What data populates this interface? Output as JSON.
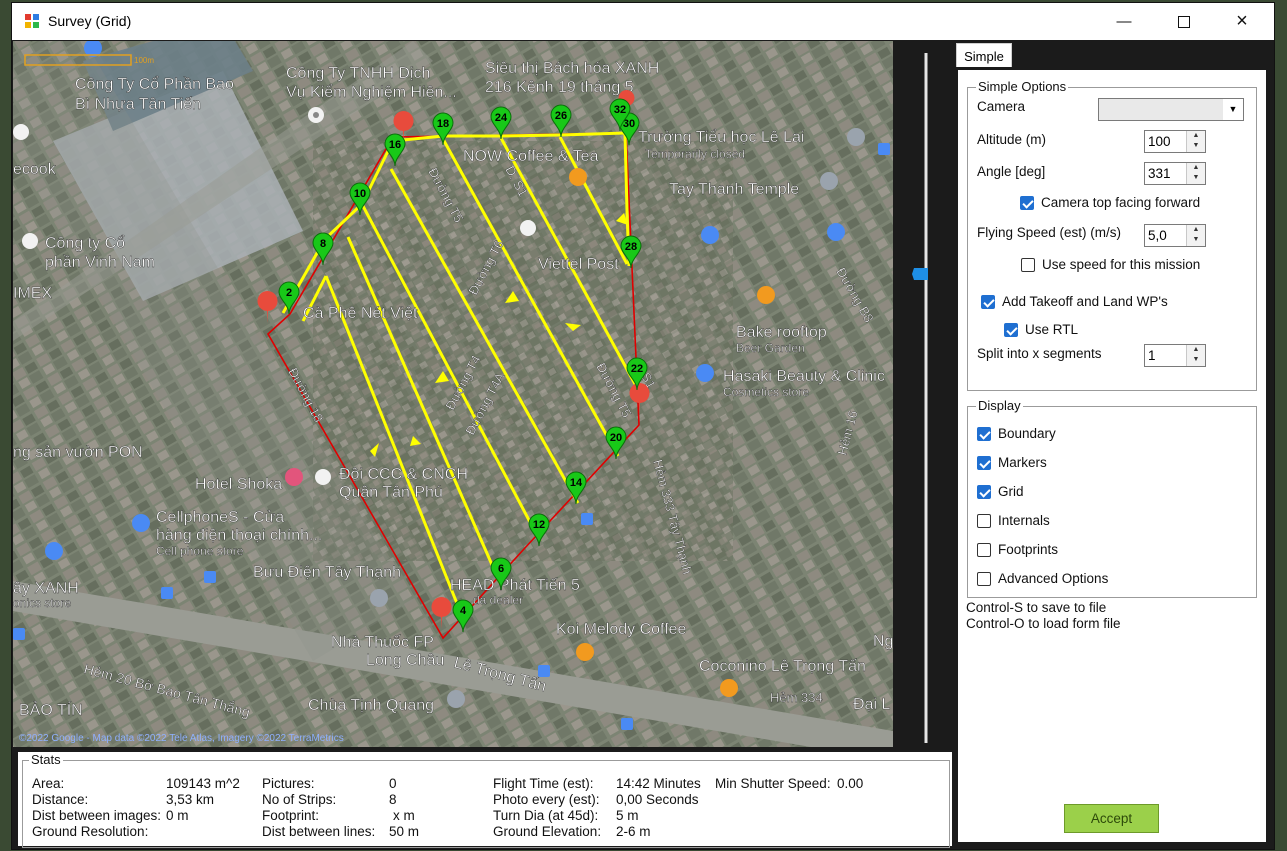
{
  "window": {
    "title": "Survey (Grid)"
  },
  "map": {
    "labels": [
      "Công Ty Cổ Phần Bao",
      "Bì Nhựa Tân Tiến",
      "Công Ty TNHH Dịch",
      "Vụ Kiểm Nghiệm Hiện...",
      "Siêu thị Bách hóa XANH",
      "216 Kênh 19 tháng 5",
      "Trường Tiểu học Lê Lai",
      "Temporarily closed",
      "NOW Coffee & Tea",
      "Tay Thanh Temple",
      "ecook",
      "Công ty Cổ",
      "phần Vinh Nam",
      "IMEX",
      "Viettel Post",
      "Cà Phê Nét Việt",
      "Bake rooftop",
      "Beer Garden",
      "Hasaki Beauty & Clinic",
      "Cosmetics store",
      "ng sản vườn PON",
      "Hotel Shoka",
      "Đội CCC & CNCH",
      "Quận Tân Phú",
      "CellphoneS - Cửa",
      "hàng điện thoại chính...",
      "Cell phone store",
      "Bưu Điện Tây Thạnh",
      "HEAD Phát Tiến 5",
      "da dealer",
      "ây XANH",
      "onics store",
      "Koi Melody Coffee",
      "Nhà Thuốc FP",
      "Long Châu",
      "Lê Trọng Tấn",
      "Coconino Lê Trọng Tấn",
      "Hẻm 334",
      "Đại L",
      "Ng",
      "Hẻm 20 Bờ Bao Tân Thắng",
      "Chùa Tịnh Quang",
      "BẢO TÍN",
      "Hẻm 333 Tây Thạnh",
      "Hẻm 16",
      "Đường B8",
      "Đường T5",
      "Đường T6",
      "Đường T4",
      "Đường T4A",
      "Đường T5",
      "Đường 18",
      "D. S1",
      "D. S1"
    ],
    "scale_text": "100m",
    "attribution": "©2022 Google - Map data ©2022 Tele Atlas, Imagery ©2022 TerraMetrics",
    "waypoints": [
      "2",
      "4",
      "6",
      "8",
      "10",
      "12",
      "14",
      "16",
      "18",
      "20",
      "22",
      "24",
      "26",
      "28",
      "30",
      "32"
    ]
  },
  "panel": {
    "tab": "Simple",
    "simple_options": {
      "title": "Simple Options",
      "camera_label": "Camera",
      "camera_value": "",
      "altitude_label": "Altitude (m)",
      "altitude_value": "100",
      "angle_label": "Angle [deg]",
      "angle_value": "331",
      "camera_top_label": "Camera top facing forward",
      "camera_top_checked": true,
      "speed_label": "Flying Speed (est) (m/s)",
      "speed_value": "5,0",
      "use_speed_label": "Use speed for this mission",
      "use_speed_checked": false,
      "takeoff_label": "Add Takeoff and Land WP's",
      "takeoff_checked": true,
      "rtl_label": "Use RTL",
      "rtl_checked": true,
      "split_label": "Split into x segments",
      "split_value": "1"
    },
    "display": {
      "title": "Display",
      "items": [
        {
          "label": "Boundary",
          "checked": true
        },
        {
          "label": "Markers",
          "checked": true
        },
        {
          "label": "Grid",
          "checked": true
        },
        {
          "label": "Internals",
          "checked": false
        },
        {
          "label": "Footprints",
          "checked": false
        },
        {
          "label": "Advanced Options",
          "checked": false
        }
      ]
    },
    "hint1": "Control-S to save to file",
    "hint2": "Control-O to load form file",
    "accept_label": "Accept"
  },
  "stats": {
    "title": "Stats",
    "area_label": "Area:",
    "area_value": "109143 m^2",
    "distance_label": "Distance:",
    "distance_value": "3,53 km",
    "dist_images_label": "Dist between images:",
    "dist_images_value": "0 m",
    "ground_res_label": "Ground Resolution:",
    "ground_res_value": "",
    "pictures_label": "Pictures:",
    "pictures_value": "0",
    "strips_label": "No of Strips:",
    "strips_value": "8",
    "footprint_label": "Footprint:",
    "footprint_value": "x  m",
    "dist_lines_label": "Dist between lines:",
    "dist_lines_value": "50 m",
    "flight_time_label": "Flight Time (est):",
    "flight_time_value": "14:42 Minutes",
    "photo_every_label": "Photo every (est):",
    "photo_every_value": "0,00 Seconds",
    "turn_dia_label": "Turn Dia (at 45d):",
    "turn_dia_value": "5 m",
    "ground_elev_label": "Ground Elevation:",
    "ground_elev_value": "2-6 m",
    "min_shutter_label": "Min Shutter Speed:",
    "min_shutter_value": "0.00"
  },
  "colors": {
    "boundary": "#e00000",
    "grid": "#ffff00",
    "marker": "#1ec81e",
    "accept": "#9bd04a",
    "checkbox": "#1f6fd1"
  }
}
